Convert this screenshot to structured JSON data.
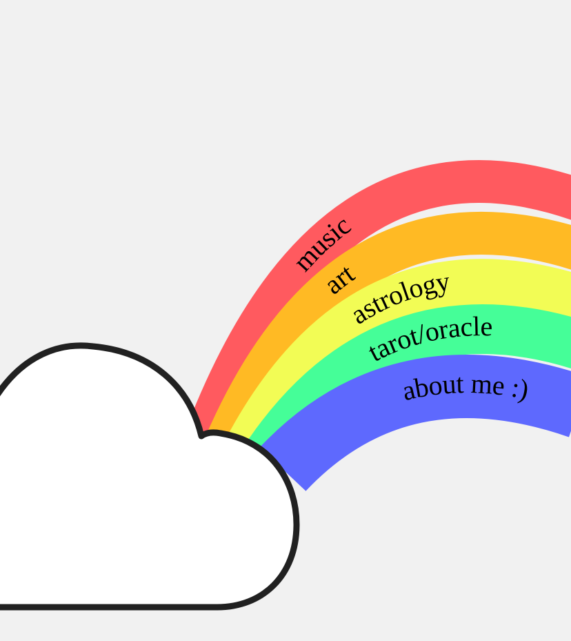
{
  "background_color": "#f1f1f1",
  "nav": {
    "items": [
      {
        "label": "music",
        "color": "#ff5a5f"
      },
      {
        "label": "art",
        "color": "#ffba24"
      },
      {
        "label": "astrology",
        "color": "#f2fc55"
      },
      {
        "label": "tarot/oracle",
        "color": "#45fe98"
      },
      {
        "label": "about me :)",
        "color": "#5e69fe"
      }
    ]
  },
  "cloud": {
    "fill": "#ffffff",
    "stroke": "#212121"
  }
}
